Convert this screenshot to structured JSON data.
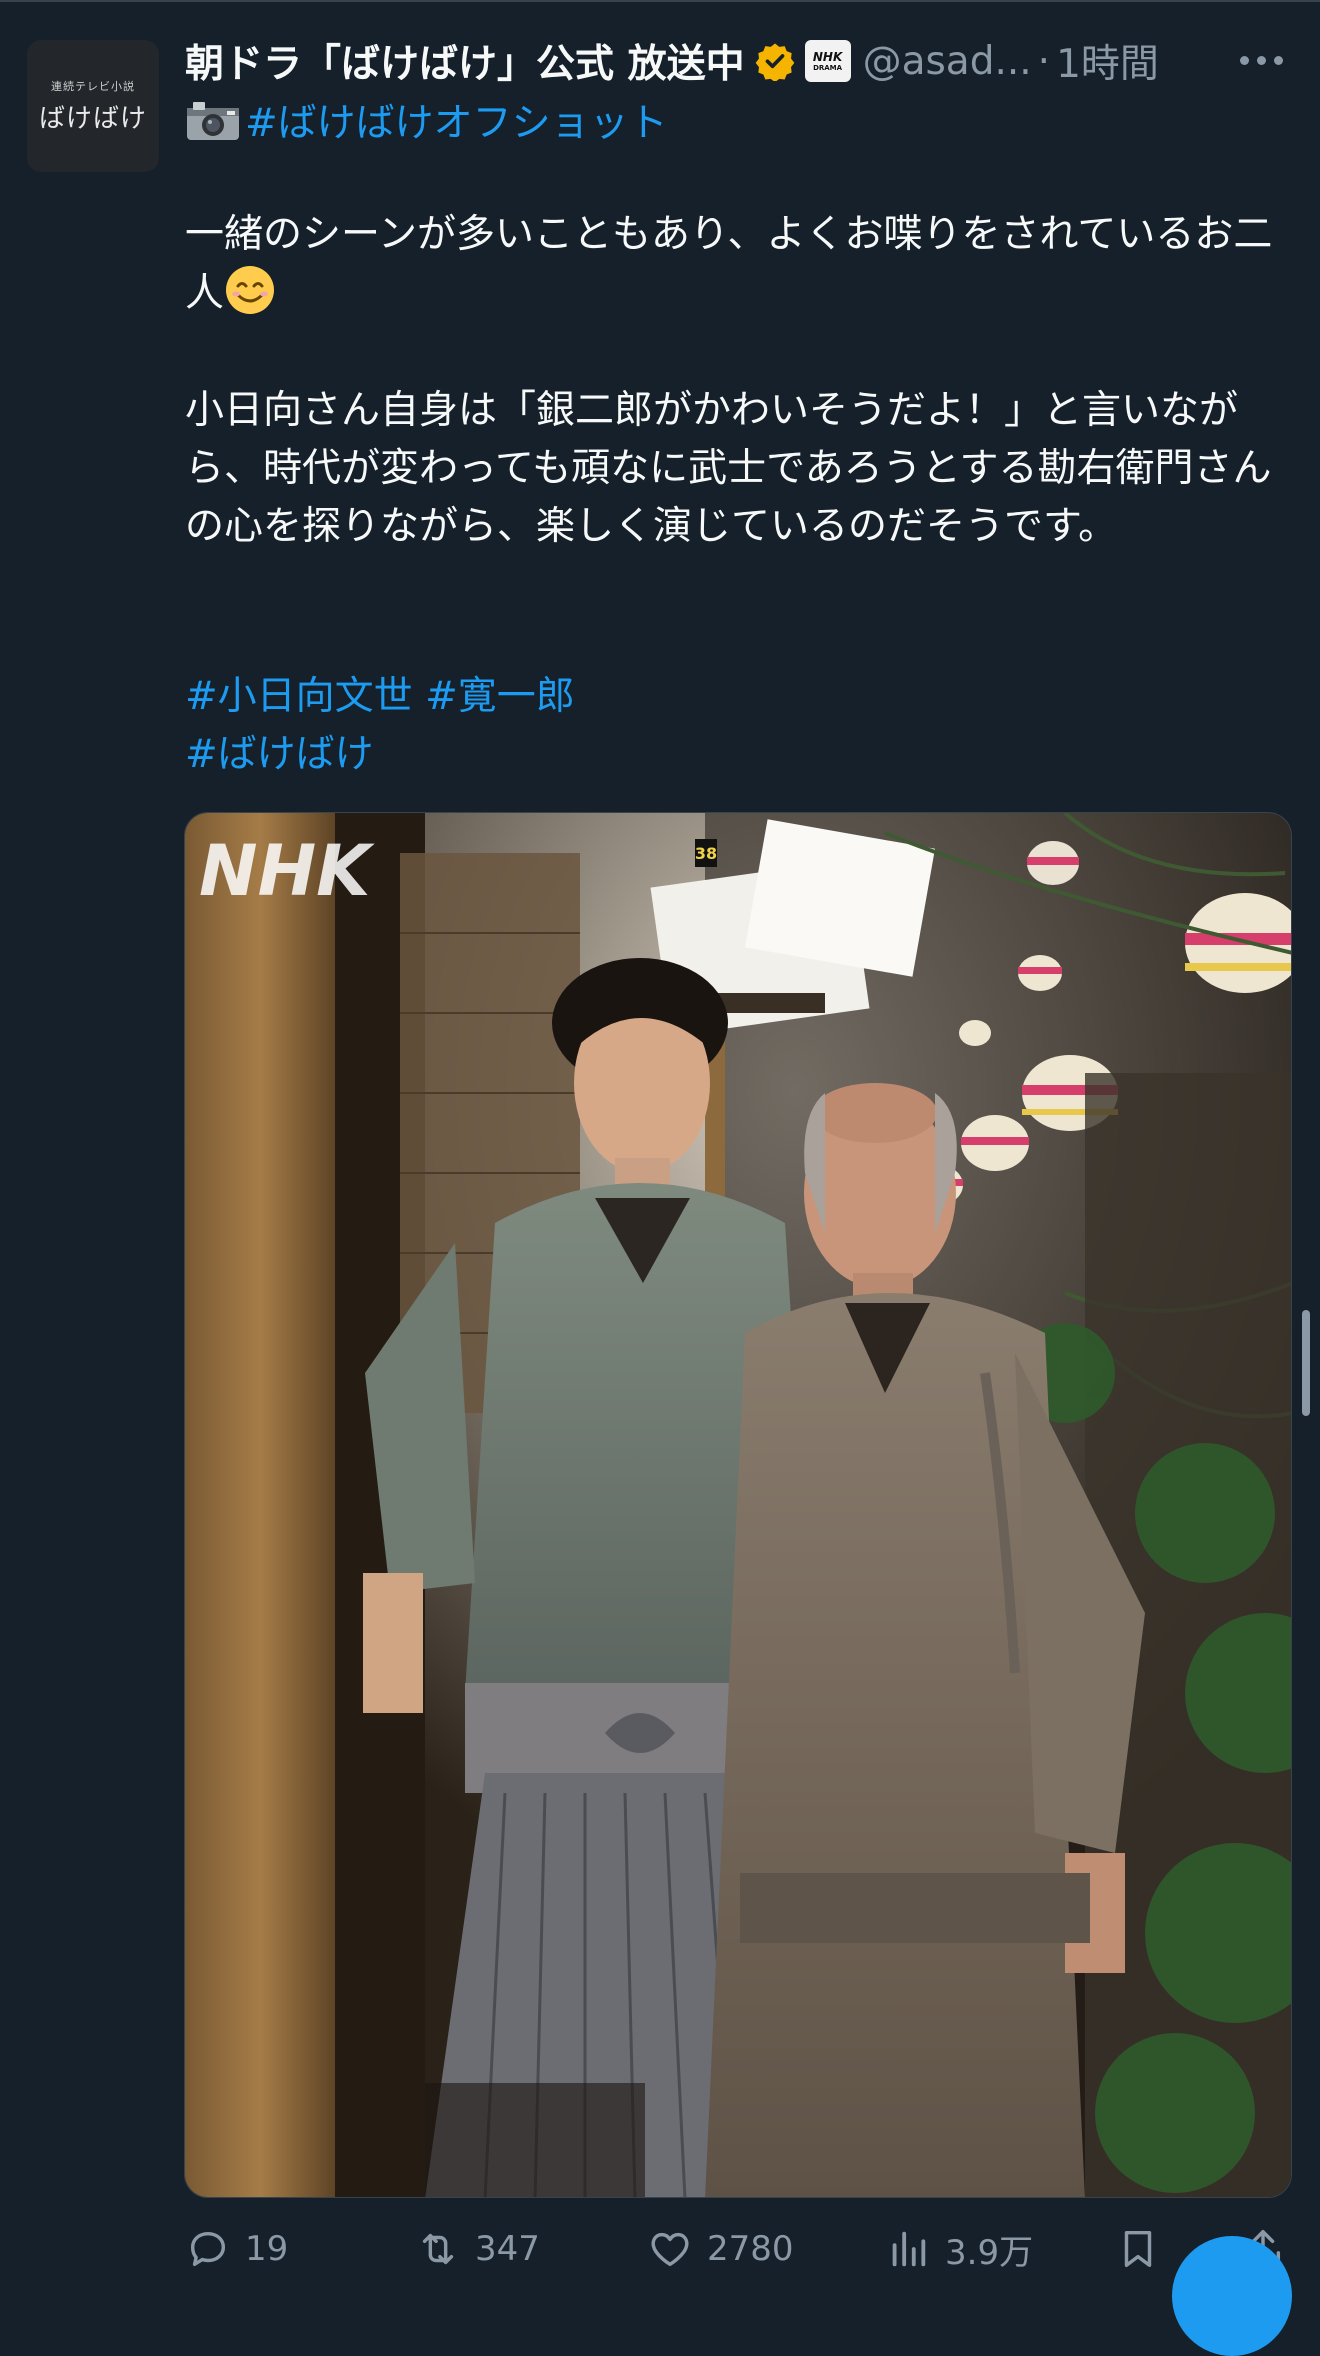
{
  "tweet": {
    "display_name": "朝ドラ「ばけばけ」公式 放送中",
    "handle": "@asad...",
    "separator": "·",
    "time": "1時間",
    "avatar": {
      "small_text": "連続テレビ小説",
      "logo_text": "ばけばけ"
    },
    "affiliate_badge": {
      "line1": "NHK",
      "line2": "DRAMA"
    },
    "camera_icon": "camera-with-flash-icon",
    "tagline_hashtag": "#ばけばけオフショット",
    "paragraph1": "一緒のシーンが多いこともあり、よくお喋りをされているお二人",
    "paragraph1_emoji": "smiling-face-icon",
    "paragraph2": "小日向さん自身は「銀二郎がかわいそうだよ！」と言いながら、時代が変わっても頑なに武士であろうとする勘右衛門さんの心を探りながら、楽しく演じているのだそうです。",
    "hashtags_line1": [
      "#小日向文世",
      "#寛一郎"
    ],
    "hashtags_line2": "#ばけばけ",
    "photo": {
      "watermark": "NHK",
      "sign_number": "38"
    }
  },
  "actions": {
    "replies": "19",
    "retweets": "347",
    "likes": "2780",
    "views": "3.9万"
  },
  "colors": {
    "background": "#15202b",
    "text": "#f7f9f9",
    "secondary": "#8b98a5",
    "link": "#1d9bf0",
    "verified": "#f4b400"
  }
}
